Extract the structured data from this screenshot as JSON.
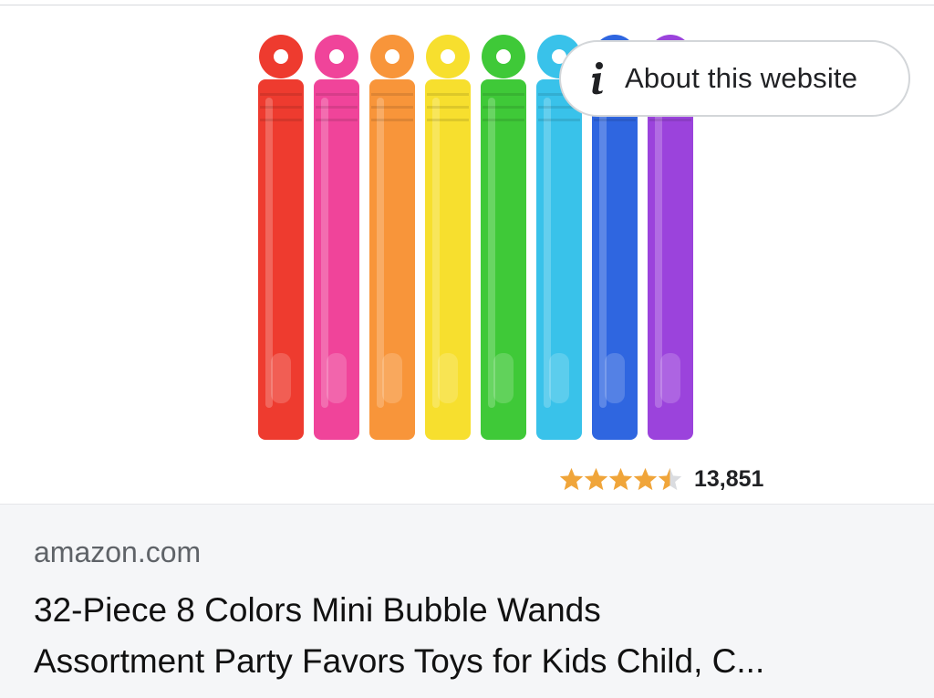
{
  "about_chip": {
    "label": "About this website",
    "icon": "info-icon"
  },
  "product_image": {
    "wand_colors": [
      "#ee3b2f",
      "#f0449a",
      "#f8953a",
      "#f7df2e",
      "#3fc938",
      "#39c2ea",
      "#2f66e0",
      "#9b43dc"
    ]
  },
  "rating": {
    "stars": 4.5,
    "max_stars": 5,
    "count": "13,851",
    "star_color": "#f0a53a"
  },
  "result": {
    "source": "amazon.com",
    "title_line1": "32-Piece 8 Colors Mini Bubble Wands",
    "title_line2": "Assortment Party Favors Toys for Kids Child, C..."
  }
}
